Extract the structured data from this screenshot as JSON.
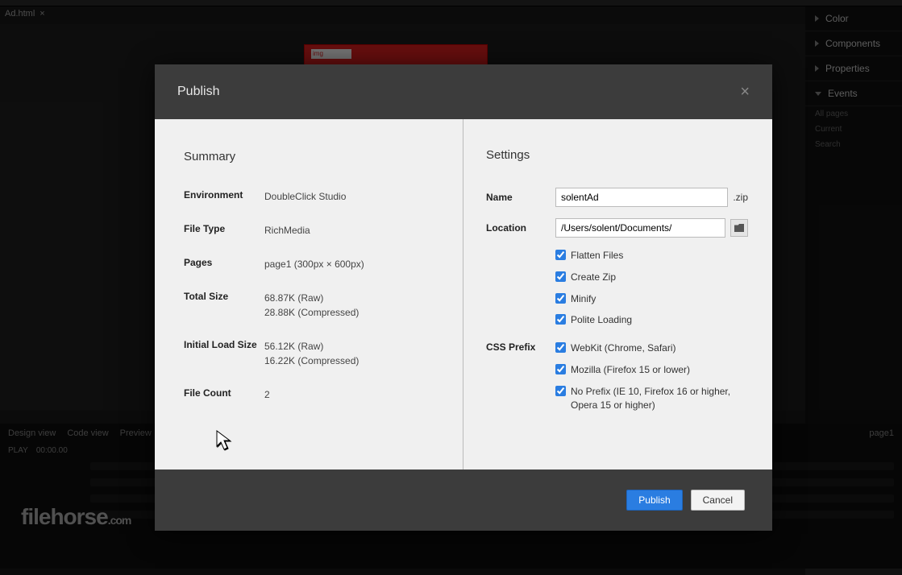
{
  "background": {
    "tab_name": "Ad.html",
    "right_panels": [
      "Color",
      "Components",
      "Properties",
      "Events"
    ],
    "right_subs": [
      "All pages",
      "Current",
      "Search"
    ],
    "views": [
      "Design view",
      "Code view",
      "Preview"
    ],
    "timeline": {
      "play_label": "PLAY",
      "time": "00:00.00",
      "page_label": "page1"
    },
    "red_box_label": "img"
  },
  "modal": {
    "title": "Publish",
    "close_label": "×",
    "summary": {
      "heading": "Summary",
      "environment_label": "Environment",
      "environment_value": "DoubleClick Studio",
      "filetype_label": "File Type",
      "filetype_value": "RichMedia",
      "pages_label": "Pages",
      "pages_value": "page1 (300px × 600px)",
      "totalsize_label": "Total Size",
      "totalsize_raw": "68.87K (Raw)",
      "totalsize_comp": "28.88K (Compressed)",
      "initload_label": "Initial Load Size",
      "initload_raw": "56.12K (Raw)",
      "initload_comp": "16.22K (Compressed)",
      "filecount_label": "File Count",
      "filecount_value": "2"
    },
    "settings": {
      "heading": "Settings",
      "name_label": "Name",
      "name_value": "solentAd",
      "name_ext": ".zip",
      "location_label": "Location",
      "location_value": "/Users/solent/Documents/",
      "flatten_label": "Flatten Files",
      "createzip_label": "Create Zip",
      "minify_label": "Minify",
      "polite_label": "Polite Loading",
      "cssprefix_label": "CSS Prefix",
      "webkit_label": "WebKit (Chrome, Safari)",
      "mozilla_label": "Mozilla (Firefox 15 or lower)",
      "noprefix_label": "No Prefix (IE 10, Firefox 16 or higher, Opera 15 or higher)"
    },
    "footer": {
      "publish_label": "Publish",
      "cancel_label": "Cancel"
    }
  },
  "watermark": {
    "main": "filehorse",
    "suffix": ".com"
  }
}
